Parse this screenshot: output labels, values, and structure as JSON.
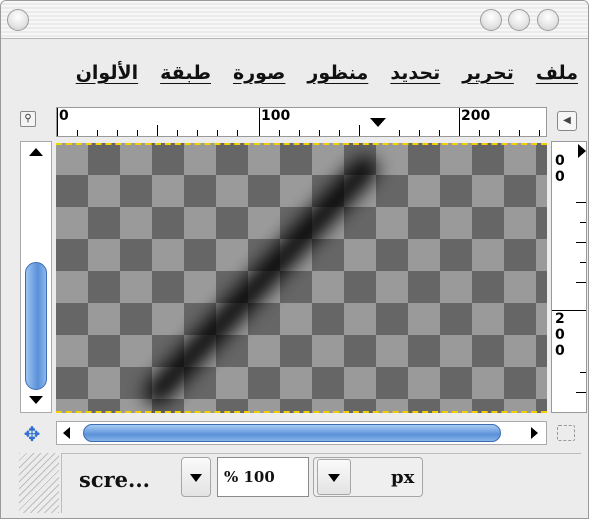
{
  "titlebar": {
    "buttons": [
      "close-button",
      "minimize-button",
      "zoom-button"
    ]
  },
  "menubar": {
    "items": [
      {
        "label": "ملف"
      },
      {
        "label": "تحرير"
      },
      {
        "label": "تحديد"
      },
      {
        "label": "منظور"
      },
      {
        "label": "صورة"
      },
      {
        "label": "طبقة"
      },
      {
        "label": "الألوان"
      }
    ]
  },
  "ruler": {
    "horizontal_labels": [
      "0",
      "100",
      "200"
    ],
    "vertical_labels": [
      "0",
      "0",
      "2",
      "0",
      "0"
    ]
  },
  "statusbar": {
    "unit_combo": "scre...",
    "zoom_value": "% 100",
    "unit": "px"
  },
  "icons": {
    "navigation": "magnifier-corner-icon",
    "quickmask": "quick-mask-icon",
    "move": "move-cross-icon",
    "resize_grip": "resize-grip-icon"
  }
}
